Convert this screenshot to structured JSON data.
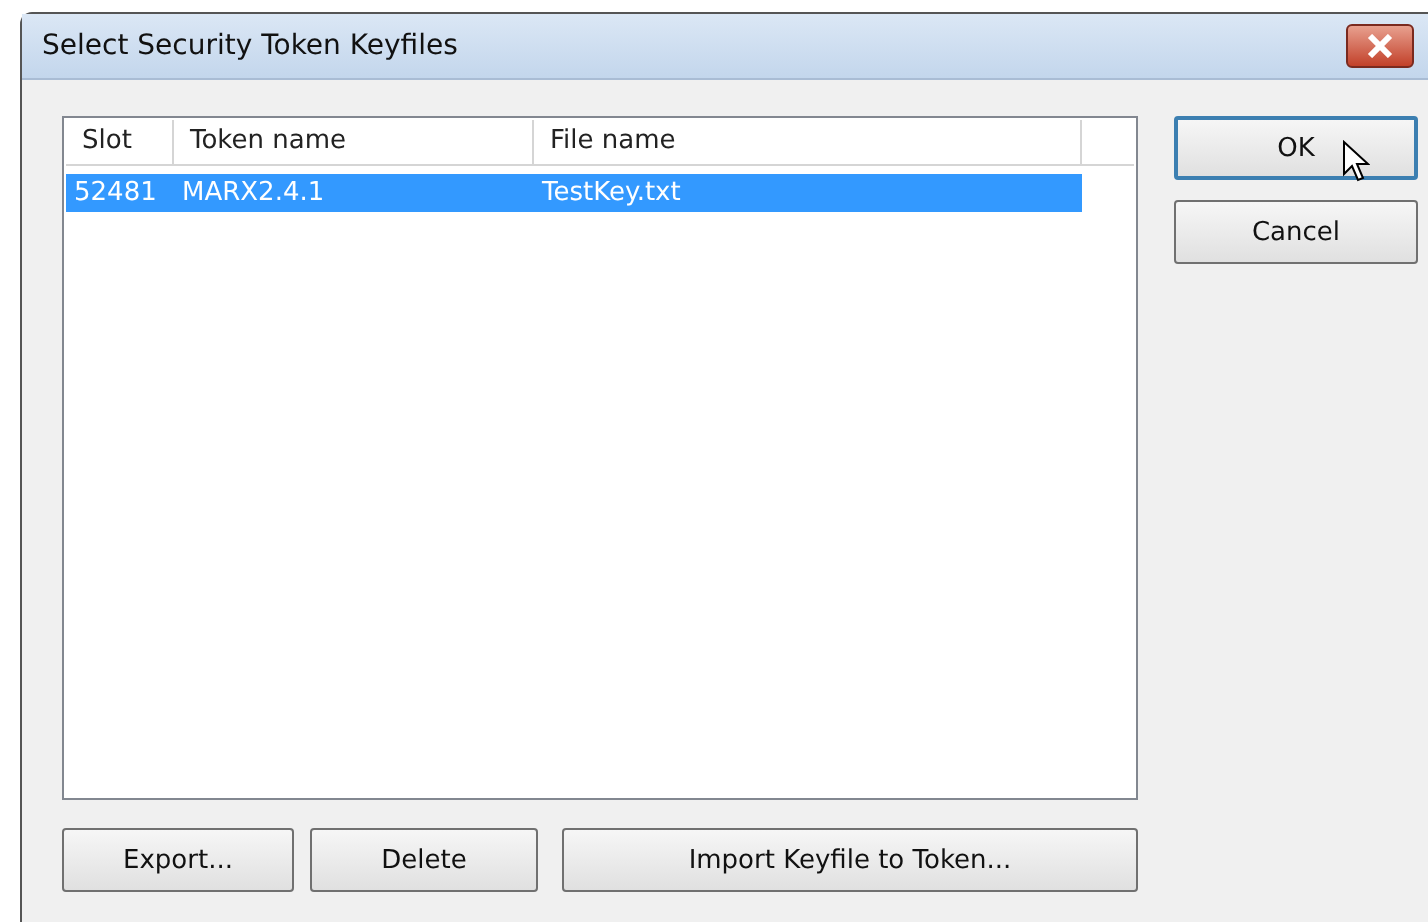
{
  "window": {
    "title": "Select Security Token Keyfiles"
  },
  "table": {
    "columns": [
      "Slot",
      "Token name",
      "File name"
    ],
    "rows": [
      {
        "cells": [
          "52481",
          "MARX2.4.1",
          "TestKey.txt"
        ],
        "selected": true
      }
    ]
  },
  "side_buttons": [
    {
      "label": "OK",
      "default": true
    },
    {
      "label": "Cancel",
      "default": false
    }
  ],
  "bottom_buttons": [
    "Export...",
    "Delete",
    "Import Keyfile to Token..."
  ]
}
